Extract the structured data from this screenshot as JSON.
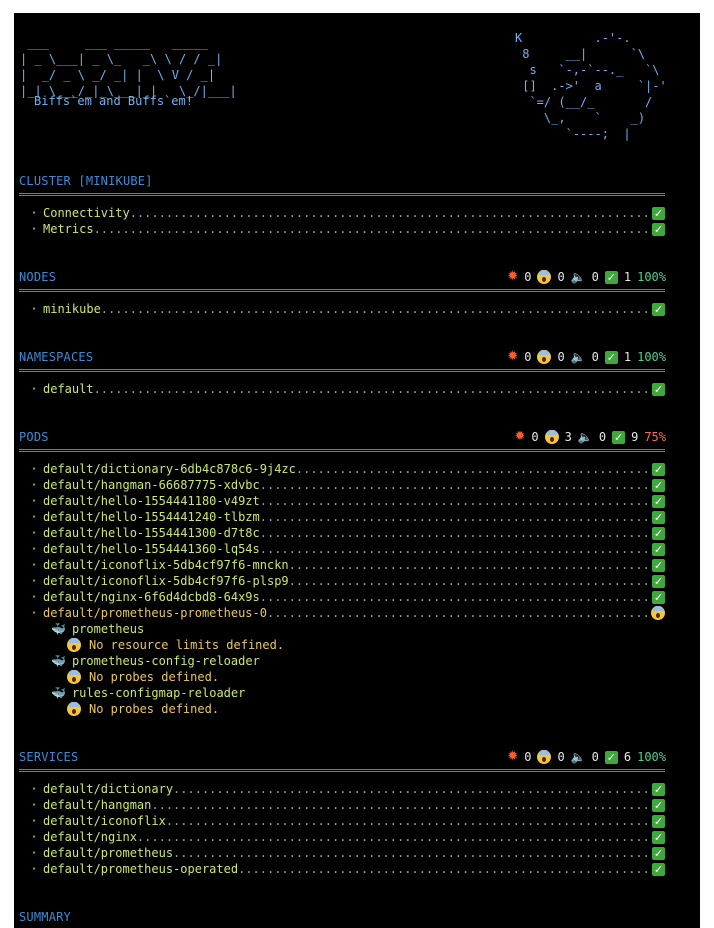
{
  "logo": {
    "ascii": " ___     ___ _____   _____\n| _ \\___| _ \\_   _\\ \\ / / _|\n|  _/ _ \\ _/ _| |  \\ V / _|\n|_| \\___/_|_\\___|_|   \\_/|___|",
    "tagline": "Biffs`em and Buffs`em!"
  },
  "k8s_art": "K          .-'-.\n 8     __|      `\\\n  s   `-,-`--._   `\\\n []  .->'  a     `|-'\n  `=/ (__/_       /\n    \\_,    `    _)\n       `----;  |",
  "sections": {
    "cluster": {
      "title": "CLUSTER [MINIKUBE]",
      "items": [
        {
          "name": "Connectivity",
          "status": "ok"
        },
        {
          "name": "Metrics",
          "status": "ok"
        }
      ]
    },
    "nodes": {
      "title": "NODES",
      "stats": {
        "errors": "0",
        "warnings": "0",
        "info": "0",
        "ok": "1",
        "score": "100%"
      },
      "items": [
        {
          "name": "minikube",
          "status": "ok"
        }
      ]
    },
    "namespaces": {
      "title": "NAMESPACES",
      "stats": {
        "errors": "0",
        "warnings": "0",
        "info": "0",
        "ok": "1",
        "score": "100%"
      },
      "items": [
        {
          "name": "default",
          "status": "ok"
        }
      ]
    },
    "pods": {
      "title": "PODS",
      "stats": {
        "errors": "0",
        "warnings": "3",
        "info": "0",
        "ok": "9",
        "score": "75%"
      },
      "items": [
        {
          "name": "default/dictionary-6db4c878c6-9j4zc",
          "status": "ok"
        },
        {
          "name": "default/hangman-66687775-xdvbc",
          "status": "ok"
        },
        {
          "name": "default/hello-1554441180-v49zt",
          "status": "ok"
        },
        {
          "name": "default/hello-1554441240-tlbzm",
          "status": "ok"
        },
        {
          "name": "default/hello-1554441300-d7t8c",
          "status": "ok"
        },
        {
          "name": "default/hello-1554441360-lq54s",
          "status": "ok"
        },
        {
          "name": "default/iconoflix-5db4cf97f6-mnckn",
          "status": "ok"
        },
        {
          "name": "default/iconoflix-5db4cf97f6-plsp9",
          "status": "ok"
        },
        {
          "name": "default/nginx-6f6d4dcbd8-64x9s",
          "status": "ok"
        },
        {
          "name": "default/prometheus-prometheus-0",
          "status": "warn"
        }
      ],
      "containers": [
        {
          "name": "prometheus",
          "issue": "No resource limits defined."
        },
        {
          "name": "prometheus-config-reloader",
          "issue": "No probes defined."
        },
        {
          "name": "rules-configmap-reloader",
          "issue": "No probes defined."
        }
      ]
    },
    "services": {
      "title": "SERVICES",
      "stats": {
        "errors": "0",
        "warnings": "0",
        "info": "0",
        "ok": "6",
        "score": "100%"
      },
      "items": [
        {
          "name": "default/dictionary",
          "status": "ok"
        },
        {
          "name": "default/hangman",
          "status": "ok"
        },
        {
          "name": "default/iconoflix",
          "status": "ok"
        },
        {
          "name": "default/nginx",
          "status": "ok"
        },
        {
          "name": "default/prometheus",
          "status": "ok"
        },
        {
          "name": "default/prometheus-operated",
          "status": "ok"
        }
      ]
    },
    "summary": {
      "title": "SUMMARY"
    }
  },
  "icons": {
    "bullet": "·",
    "error": "explosion-icon",
    "warning": "scream-icon",
    "info": "speaker-icon",
    "ok": "check-box-icon",
    "container": "whale-icon"
  },
  "colors": {
    "background": "#000000",
    "section_title": "#3d8bd4",
    "item_name": "#c9e86f",
    "ok_green": "#3ea83a",
    "score_ok": "#4fd18b",
    "score_warn": "#ff6b5a",
    "issue_text": "#e8c85a"
  }
}
